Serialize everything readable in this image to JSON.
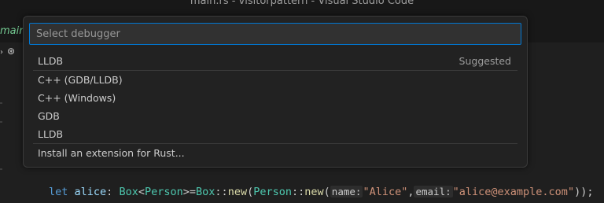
{
  "window": {
    "title": "main.rs - visitorpattern - Visual Studio Code"
  },
  "editor": {
    "tab_fragment": "main.r",
    "code": {
      "kw_let": "let",
      "var_name": "alice",
      "colon": ":",
      "type_box": "Box",
      "lt": "<",
      "type_person": "Person",
      "gt_eq": ">=",
      "box_ref": "Box",
      "sep1": "::",
      "fn_new": "new",
      "paren_open": "(",
      "person_ref": "Person",
      "sep2": "::",
      "fn_new2": "new",
      "paren_open2": "(",
      "hint_name": "name:",
      "str_alice": "\"Alice\"",
      "comma": ",",
      "hint_email": "email:",
      "str_email": "\"alice@example.com\"",
      "close": "));"
    }
  },
  "quick_pick": {
    "placeholder": "Select debugger",
    "items": [
      {
        "label": "LLDB",
        "description": "Suggested"
      },
      {
        "label": "C++ (GDB/LLDB)"
      },
      {
        "label": "C++ (Windows)"
      },
      {
        "label": "GDB"
      },
      {
        "label": "LLDB"
      },
      {
        "label": "Install an extension for Rust..."
      }
    ]
  },
  "colors": {
    "accent": "#0078d4",
    "background": "#1f1f1f",
    "panel": "#222222"
  }
}
